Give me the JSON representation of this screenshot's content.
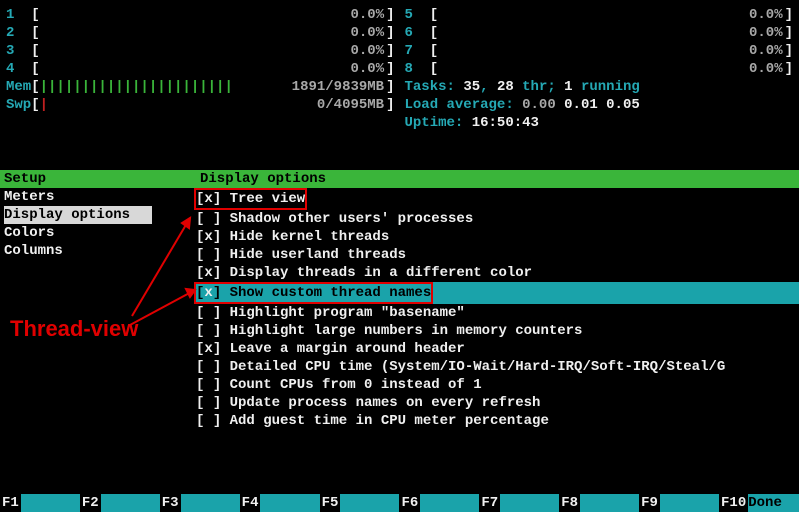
{
  "cpus_left": [
    {
      "n": "1",
      "val": "0.0%"
    },
    {
      "n": "2",
      "val": "0.0%"
    },
    {
      "n": "3",
      "val": "0.0%"
    },
    {
      "n": "4",
      "val": "0.0%"
    }
  ],
  "cpus_right": [
    {
      "n": "5",
      "val": "0.0%"
    },
    {
      "n": "6",
      "val": "0.0%"
    },
    {
      "n": "7",
      "val": "0.0%"
    },
    {
      "n": "8",
      "val": "0.0%"
    }
  ],
  "mem": {
    "label": "Mem",
    "fill": "|||||||||||||||||||||||",
    "value": "1891/9839MB"
  },
  "swp": {
    "label": "Swp",
    "fill": "|",
    "value": "0/4095MB"
  },
  "tasks": {
    "label": "Tasks: ",
    "total": "35",
    "sep1": ", ",
    "thr": "28",
    "thrlabel": " thr; ",
    "running": "1",
    "runlabel": " running"
  },
  "load": {
    "label": "Load average: ",
    "v1": "0.00",
    "v2": "0.01",
    "v3": "0.05"
  },
  "uptime": {
    "label": "Uptime: ",
    "value": "16:50:43"
  },
  "menu_header": "Setup",
  "menu_items": [
    "Meters",
    "Display options",
    "Colors",
    "Columns"
  ],
  "options_header": "Display options",
  "options": [
    {
      "checked": true,
      "label": "Tree view",
      "boxed": true
    },
    {
      "checked": false,
      "label": "Shadow other users' processes"
    },
    {
      "checked": true,
      "label": "Hide kernel threads"
    },
    {
      "checked": false,
      "label": "Hide userland threads"
    },
    {
      "checked": true,
      "label": "Display threads in a different color"
    },
    {
      "checked": true,
      "label": "Show custom thread names",
      "selected": true,
      "boxed": true
    },
    {
      "checked": false,
      "label": "Highlight program \"basename\""
    },
    {
      "checked": false,
      "label": "Highlight large numbers in memory counters"
    },
    {
      "checked": true,
      "label": "Leave a margin around header"
    },
    {
      "checked": false,
      "label": "Detailed CPU time (System/IO-Wait/Hard-IRQ/Soft-IRQ/Steal/G"
    },
    {
      "checked": false,
      "label": "Count CPUs from 0 instead of 1"
    },
    {
      "checked": false,
      "label": "Update process names on every refresh"
    },
    {
      "checked": false,
      "label": "Add guest time in CPU meter percentage"
    }
  ],
  "annotation": "Thread-view",
  "footer": [
    {
      "key": "F1",
      "label": ""
    },
    {
      "key": "F2",
      "label": ""
    },
    {
      "key": "F3",
      "label": ""
    },
    {
      "key": "F4",
      "label": ""
    },
    {
      "key": "F5",
      "label": ""
    },
    {
      "key": "F6",
      "label": ""
    },
    {
      "key": "F7",
      "label": ""
    },
    {
      "key": "F8",
      "label": ""
    },
    {
      "key": "F9",
      "label": ""
    },
    {
      "key": "F10",
      "label": "Done"
    }
  ]
}
